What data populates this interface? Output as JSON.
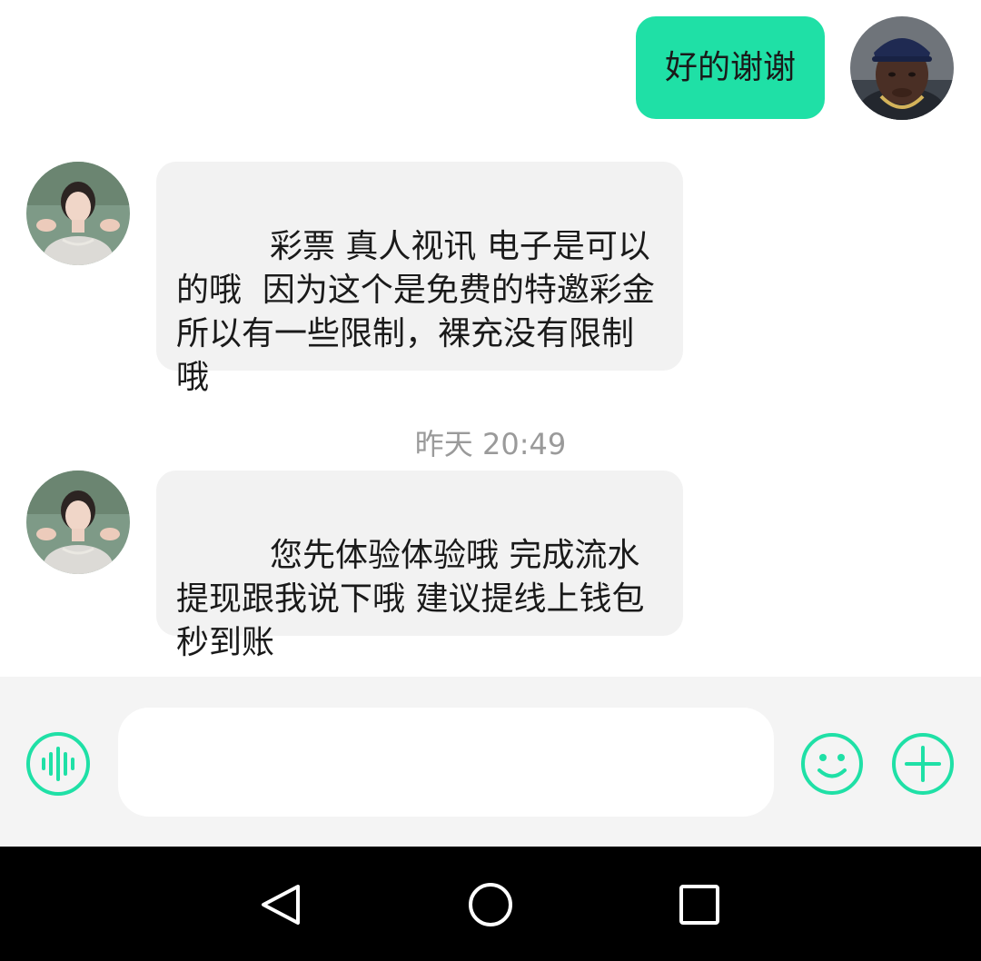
{
  "messages": [
    {
      "direction": "outgoing",
      "sender": "me",
      "text": "好的谢谢"
    },
    {
      "direction": "incoming",
      "sender": "contact",
      "text": " 彩票 真人视讯 电子是可以的哦  因为这个是免费的特邀彩金  所以有一些限制，裸充没有限制哦"
    },
    {
      "direction": "incoming",
      "sender": "contact",
      "text": " 您先体验体验哦 完成流水提现跟我说下哦 建议提线上钱包 秒到账"
    }
  ],
  "timestamp": "昨天 20:49",
  "input": {
    "value": "",
    "placeholder": ""
  },
  "icons": {
    "voice": "voice-waveform-icon",
    "emoji": "emoji-smiley-icon",
    "more": "plus-circle-icon",
    "back": "nav-back-triangle-icon",
    "home": "nav-home-circle-icon",
    "recents": "nav-recents-square-icon"
  },
  "colors": {
    "accent": "#1fe0a6",
    "incoming_bubble": "#f2f2f2",
    "input_bar": "#f4f4f4",
    "nav_bar": "#000000",
    "timestamp_text": "#9a9a9a"
  }
}
